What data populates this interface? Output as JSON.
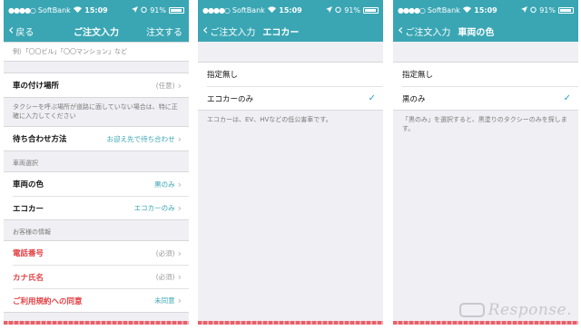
{
  "status_bar": {
    "signal": "●●●●○",
    "carrier": "SoftBank",
    "time": "15:09",
    "battery": "91%"
  },
  "screen1": {
    "back_label": "戻る",
    "title": "ご注文入力",
    "action": "注文する",
    "top_hint": "例）「〇〇ビル」「〇〇マンション」など",
    "pickup_label": "車の付け場所",
    "pickup_value": "(任意)",
    "pickup_note": "タクシーを呼ぶ場所が道路に面していない場合は、特に正確に入力してください",
    "meet_label": "待ち合わせ方法",
    "meet_value": "お迎え先で待ち合わせ",
    "vehicle_header": "車両選択",
    "color_label": "車両の色",
    "color_value": "黒のみ",
    "eco_label": "エコカー",
    "eco_value": "エコカーのみ",
    "customer_header": "お客様の情報",
    "phone_label": "電話番号",
    "phone_value": "(必須)",
    "name_label": "カナ氏名",
    "name_value": "(必須)",
    "terms_label": "ご利用規約への同意",
    "terms_value": "未同意"
  },
  "screen2": {
    "back_label": "ご注文入力",
    "title": "エコカー",
    "option1": "指定無し",
    "option2": "エコカーのみ",
    "note": "エコカーは、EV、HVなどの低公害車です。"
  },
  "screen3": {
    "back_label": "ご注文入力",
    "title": "車両の色",
    "option1": "指定無し",
    "option2": "黒のみ",
    "note": "「黒のみ」を選択すると、黒塗りのタクシーのみを探します。"
  },
  "watermark": "Response.",
  "icons": {
    "back": "chevron-left-icon",
    "row_arrow": "chevron-right-icon",
    "check": "checkmark-icon",
    "wifi": "wifi-icon",
    "location": "location-arrow-icon",
    "alarm": "alarm-clock-icon"
  },
  "colors": {
    "nav_bar": "#3aa6b4",
    "value_accent": "#3aa6b4",
    "required_label": "#e34044",
    "check": "#2f9bd0"
  }
}
